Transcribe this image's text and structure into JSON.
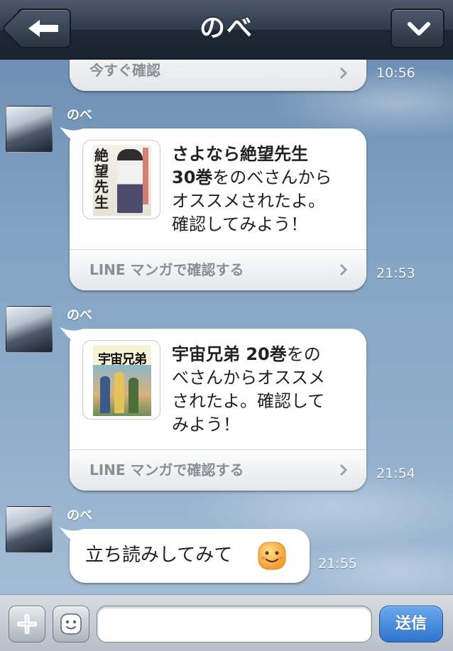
{
  "header": {
    "title": "のべ"
  },
  "messages": [
    {
      "footer_label": "今すぐ確認",
      "time": "10:56"
    },
    {
      "sender": "のべ",
      "title_bold": "さよなら絶望先生30巻",
      "text": "をのべさんからオススメされたよ。確認してみよう！",
      "line1_bold": "さよなら絶望先生",
      "line2_bold": "30巻",
      "line2_rest": "をのべさんから",
      "line3": "オススメされたよ。",
      "line4": "確認してみよう！",
      "footer_label": "LINE マンガで確認する",
      "time": "21:53",
      "cover_title": "絶望先生"
    },
    {
      "sender": "のべ",
      "line1_bold": "宇宙兄弟 20巻",
      "line1_rest": "をの",
      "line2": "べさんからオススメ",
      "line3": "されたよ。確認して",
      "line4": "みよう！",
      "footer_label": "LINE マンガで確認する",
      "time": "21:54",
      "cover_title": "宇宙兄弟"
    },
    {
      "sender": "のべ",
      "text": "立ち読みしてみて",
      "time": "21:55"
    }
  ],
  "input": {
    "value": "",
    "send_label": "送信"
  },
  "colors": {
    "send_button": "#3b82d6",
    "header": "#243040"
  }
}
